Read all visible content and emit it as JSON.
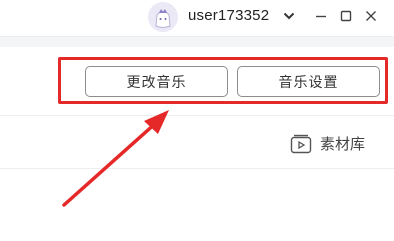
{
  "header": {
    "username": "user173352"
  },
  "toolbar": {
    "change_music_label": "更改音乐",
    "music_settings_label": "音乐设置"
  },
  "content": {
    "material_library_label": "素材库"
  },
  "annotation": {
    "color": "#e52828"
  }
}
